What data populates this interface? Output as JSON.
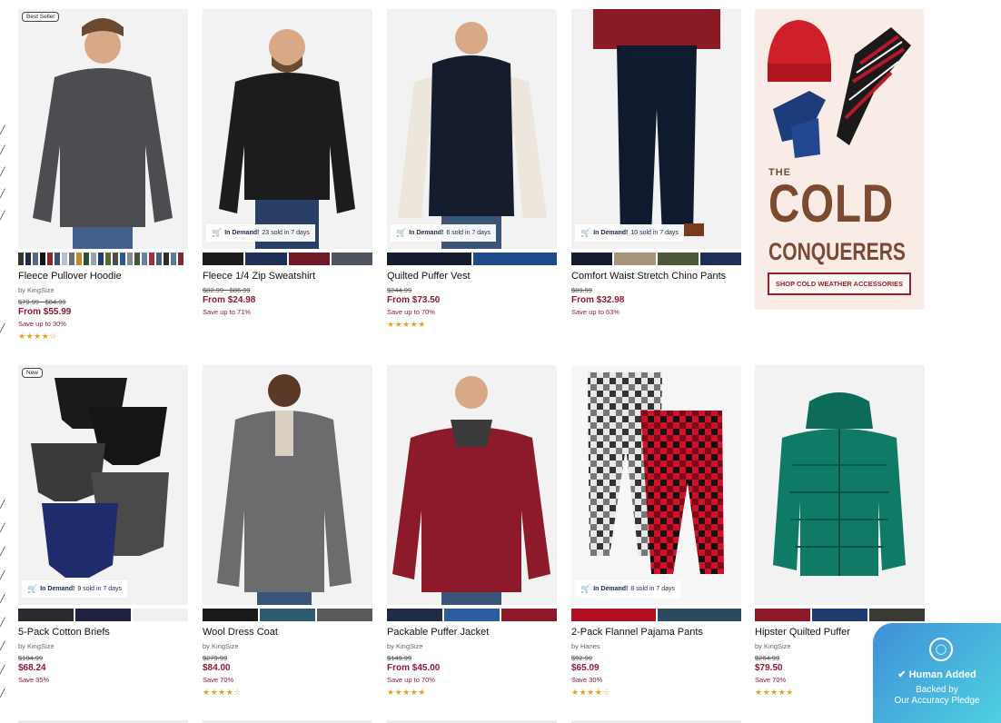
{
  "row1": [
    {
      "badge": "Best Seller",
      "name": "Fleece Pullover Hoodie",
      "brand": "by KingSize",
      "orig": "$79.99 - $84.99",
      "price": "From $55.99",
      "save": "Save up to 30%",
      "stars": "★★★★☆",
      "demand": null
    },
    {
      "badge": null,
      "name": "Fleece 1/4 Zip Sweatshirt",
      "brand": "",
      "orig": "$82.99 - $86.99",
      "price": "From $24.98",
      "save": "Save up to 71%",
      "stars": "",
      "demand": {
        "label": "In Demand!",
        "text": "23 sold in 7 days"
      }
    },
    {
      "badge": null,
      "name": "Quilted Puffer Vest",
      "brand": "",
      "orig": "$244.99",
      "price": "From $73.50",
      "save": "Save up to 70%",
      "stars": "★★★★★",
      "demand": {
        "label": "In Demand!",
        "text": "6 sold in 7 days"
      }
    },
    {
      "badge": null,
      "name": "Comfort Waist Stretch Chino Pants",
      "brand": "",
      "orig": "$89.99",
      "price": "From $32.98",
      "save": "Save up to 63%",
      "stars": "",
      "demand": {
        "label": "In Demand!",
        "text": "10 sold in 7 days"
      }
    }
  ],
  "row2": [
    {
      "badge": "New",
      "name": "5-Pack Cotton Briefs",
      "brand": "by KingSize",
      "orig": "$104.99",
      "price": "$68.24",
      "save": "Save 35%",
      "stars": "",
      "demand": {
        "label": "In Demand!",
        "text": "9 sold in 7 days"
      }
    },
    {
      "badge": null,
      "name": "Wool Dress Coat",
      "brand": "by KingSize",
      "orig": "$279.99",
      "price": "$84.00",
      "save": "Save 70%",
      "stars": "★★★★☆",
      "demand": null
    },
    {
      "badge": null,
      "name": "Packable Puffer Jacket",
      "brand": "by KingSize",
      "orig": "$149.99",
      "price": "From $45.00",
      "save": "Save up to 70%",
      "stars": "★★★★★",
      "demand": null
    },
    {
      "badge": null,
      "name": "2-Pack Flannel Pajama Pants",
      "brand": "by Hanes",
      "orig": "$92.99",
      "price": "$65.09",
      "save": "Save 30%",
      "stars": "★★★★☆",
      "demand": {
        "label": "In Demand!",
        "text": "8 sold in 7 days"
      }
    },
    {
      "badge": null,
      "name": "Hipster Quilted Puffer",
      "brand": "by KingSize",
      "orig": "$264.99",
      "price": "$79.50",
      "save": "Save 70%",
      "stars": "★★★★★",
      "demand": null
    }
  ],
  "promo": {
    "the": "THE",
    "cold": "COLD",
    "conquerers": "CONQUERERS",
    "cta": "SHOP COLD WEATHER ACCESSORIES"
  },
  "pledge": {
    "title": "Human Added",
    "line1": "Backed by",
    "line2": "Our Accuracy Pledge"
  },
  "colors": {
    "price_red": "#8c1930",
    "star": "#e3a21a",
    "promo_brown": "#7c4a33"
  }
}
